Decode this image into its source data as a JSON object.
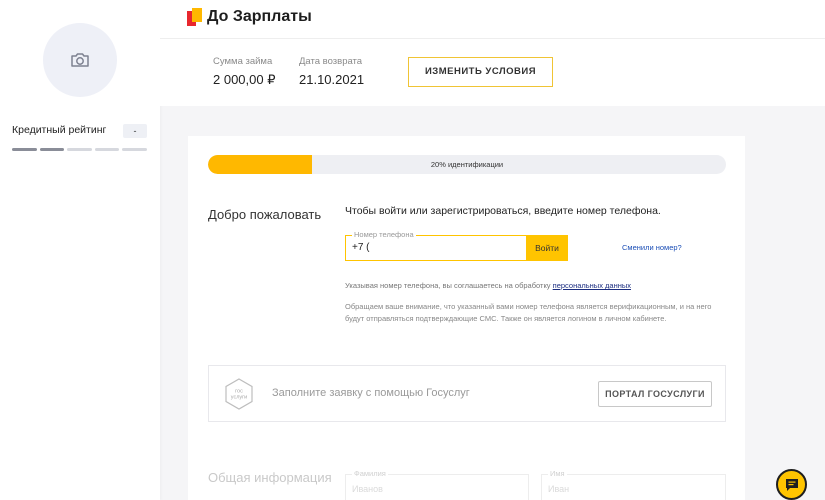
{
  "sidebar": {
    "avatar_icon": "camera-icon",
    "rating_label": "Кредитный рейтинг",
    "rating_value": "-",
    "rating_segments": 5,
    "rating_segments_active": 2
  },
  "header": {
    "brand_name": "До Зарплаты",
    "brand_colors": [
      "#e8272e",
      "#ffb800"
    ],
    "loan_amount_label": "Сумма займа",
    "loan_amount_value": "2 000,00 ₽",
    "return_date_label": "Дата возврата",
    "return_date_value": "21.10.2021",
    "change_button_label": "ИЗМЕНИТЬ УСЛОВИЯ"
  },
  "progress": {
    "label": "20% идентификации",
    "fraction": 0.2,
    "color": "#ffb800"
  },
  "login": {
    "welcome": "Добро пожаловать",
    "prompt": "Чтобы войти или зарегистрироваться, введите номер телефона.",
    "phone_label": "Номер телефона",
    "phone_value": "+7 (",
    "submit_label": "Войти",
    "changed_number_link": "Сменили номер?",
    "consent_text": "Указывая номер телефона, вы соглашаетесь на обработку ",
    "consent_link": "персональных данных",
    "notice": "Обращаем ваше внимание, что указанный вами номер телефона является верификационным, и на него будут отправляться подтверждающие СМС. Также он является логином в личном кабинете."
  },
  "gosuslugi": {
    "logo_text_line1": "гос",
    "logo_text_line2": "услуги",
    "text": "Заполните заявку с помощью Госуслуг",
    "button_label": "ПОРТАЛ ГОСУСЛУГИ"
  },
  "general_info": {
    "title": "Общая информация",
    "surname_label": "Фамилия",
    "surname_placeholder": "Иванов",
    "name_label": "Имя",
    "name_placeholder": "Иван"
  },
  "chat": {
    "icon": "chat-icon",
    "accent": "#ffc400"
  }
}
